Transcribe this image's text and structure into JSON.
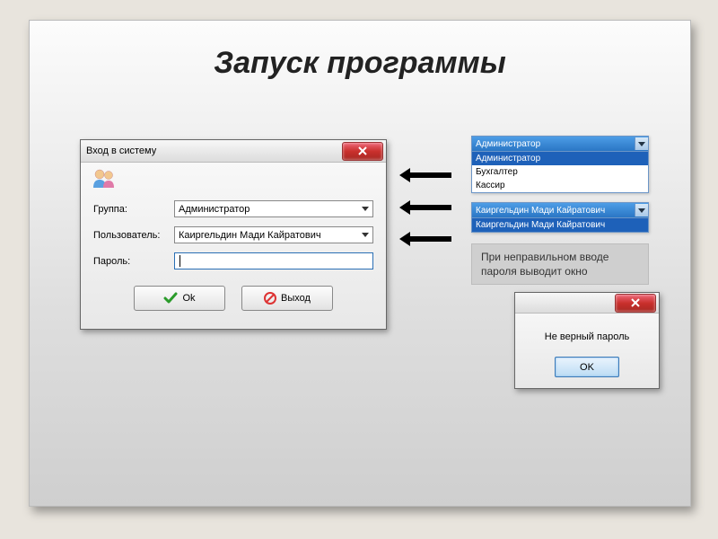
{
  "page": {
    "title": "Запуск программы"
  },
  "login": {
    "window_title": "Вход в систему",
    "labels": {
      "group": "Группа:",
      "user": "Пользователь:",
      "password": "Пароль:"
    },
    "values": {
      "group": "Администратор",
      "user": "Каиргельдин Мади Кайратович",
      "password": ""
    },
    "buttons": {
      "ok": "Ok",
      "exit": "Выход"
    }
  },
  "dropdown_group": {
    "selected": "Администратор",
    "options": [
      "Администратор",
      "Бухгалтер",
      "Кассир"
    ]
  },
  "dropdown_user": {
    "selected": "Каиргельдин Мади Кайратович",
    "options": [
      "Каиргельдин Мади Кайратович"
    ]
  },
  "note_text_line1": "При неправильном вводе",
  "note_text_line2": "пароля выводит окно",
  "error_dialog": {
    "message": "Не верный пароль",
    "ok": "OK"
  },
  "icons": {
    "close": "close-icon",
    "users": "users-icon",
    "chevron_down": "chevron-down-icon",
    "check": "check-icon",
    "no_entry": "no-entry-icon",
    "arrow_left": "arrow-left-icon"
  }
}
